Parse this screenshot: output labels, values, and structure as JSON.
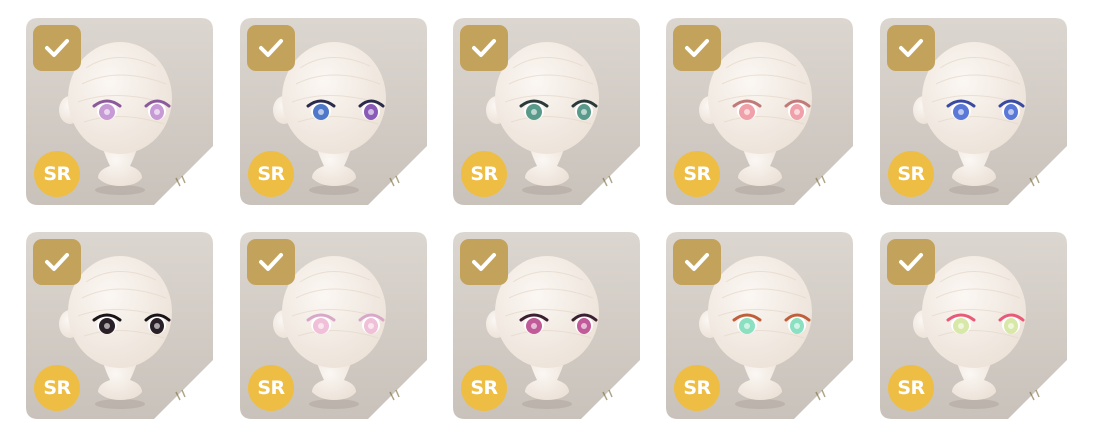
{
  "rarity_label": "SR",
  "colors": {
    "card_bg_top": "#dcd6d0",
    "card_bg_bottom": "#c9c2bb",
    "check_bg": "#c3a35c",
    "badge_bg": "#eebd43",
    "head": "#f5eee8"
  },
  "items": [
    {
      "selected": true,
      "rarity": "SR",
      "eye_style": "lilac-soft",
      "iris": "#c79ad6",
      "lash": "#8a5a9a"
    },
    {
      "selected": true,
      "rarity": "SR",
      "eye_style": "blue-violet-heterochromia",
      "iris": "#5078c8",
      "iris2": "#8a5ab8",
      "lash": "#2a2a4a"
    },
    {
      "selected": true,
      "rarity": "SR",
      "eye_style": "teal-lashes",
      "iris": "#5a9a8a",
      "lash": "#2a3a3a"
    },
    {
      "selected": true,
      "rarity": "SR",
      "eye_style": "pink-sleepy",
      "iris": "#f0a0a8",
      "lash": "#c07a7a"
    },
    {
      "selected": true,
      "rarity": "SR",
      "eye_style": "blue-sparkle",
      "iris": "#5a78d8",
      "lash": "#3a4aa0"
    },
    {
      "selected": true,
      "rarity": "SR",
      "eye_style": "dark-spiky",
      "iris": "#2a2028",
      "lash": "#1a1418"
    },
    {
      "selected": true,
      "rarity": "SR",
      "eye_style": "pale-pink",
      "iris": "#f0c0d8",
      "lash": "#d8a8c8"
    },
    {
      "selected": true,
      "rarity": "SR",
      "eye_style": "magenta-dramatic",
      "iris": "#c05a98",
      "lash": "#3a2030"
    },
    {
      "selected": true,
      "rarity": "SR",
      "eye_style": "mint-orange",
      "iris": "#8ae0c0",
      "lash": "#c0603a"
    },
    {
      "selected": true,
      "rarity": "SR",
      "eye_style": "pink-green-cute",
      "iris": "#d8e8a8",
      "lash": "#e85a78"
    }
  ]
}
